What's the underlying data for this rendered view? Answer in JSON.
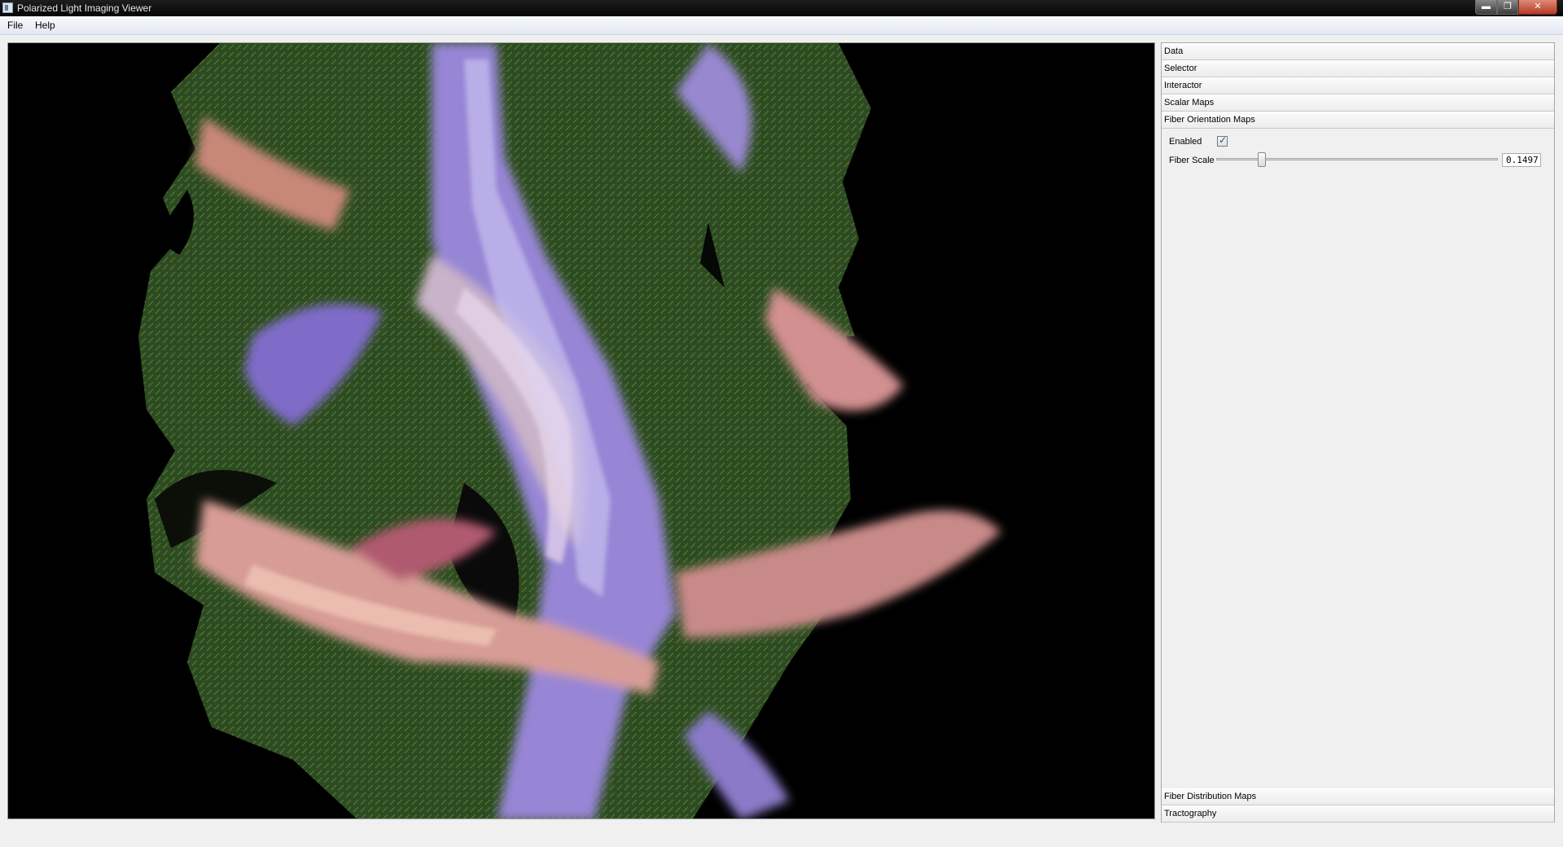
{
  "window": {
    "title": "Polarized Light Imaging Viewer",
    "controls": {
      "minimize": "▬",
      "maximize": "❐",
      "close": "✕"
    }
  },
  "menu": {
    "items": [
      "File",
      "Help"
    ]
  },
  "viewer": {
    "content": "fiber-orientation-map-image"
  },
  "side_panel": {
    "sections": [
      "Data",
      "Selector",
      "Interactor",
      "Scalar Maps",
      "Fiber Orientation Maps",
      "Fiber Distribution Maps",
      "Tractography"
    ],
    "fiber_orientation_maps": {
      "enabled_label": "Enabled",
      "enabled": true,
      "fiber_scale_label": "Fiber Scale",
      "fiber_scale_value": "0.1497",
      "fiber_scale_slider_fraction": 0.14
    }
  },
  "icons": {
    "checkmark": "checkmark-icon",
    "app": "app-icon"
  },
  "colors": {
    "title_bar": "#0a0a0a",
    "viewer_background": "#000000",
    "panel_background": "#f0f0f0",
    "checkmark": "#2a4f86"
  }
}
